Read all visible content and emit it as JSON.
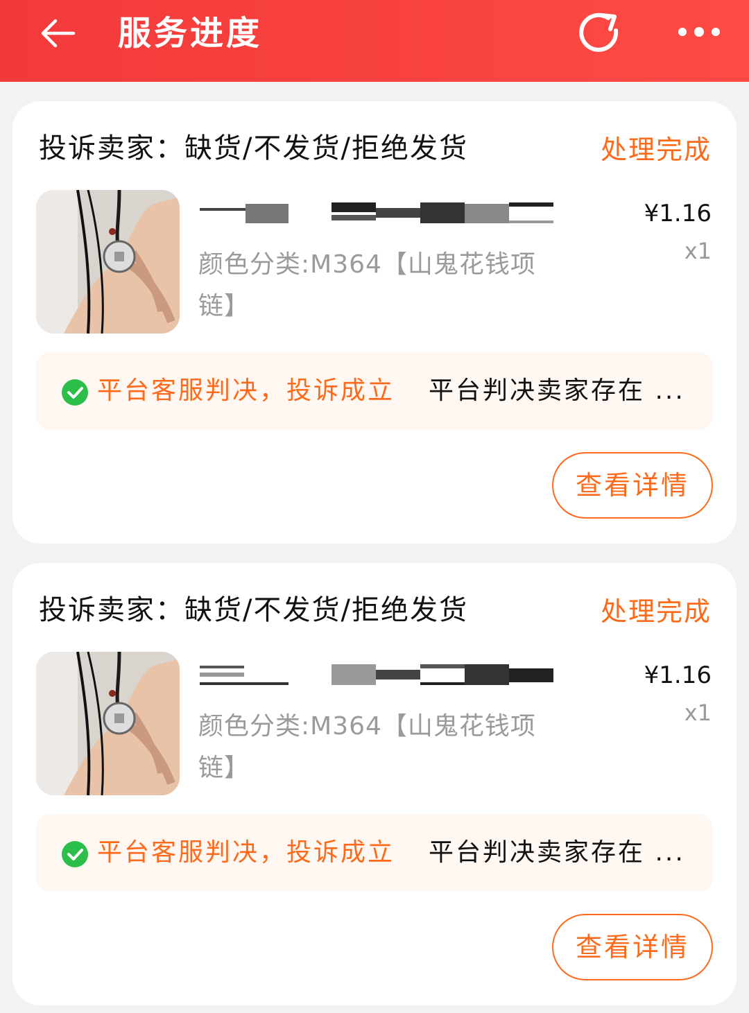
{
  "header": {
    "title": "服务进度",
    "bg_color": "#f23a3a"
  },
  "cards": [
    {
      "complaint": "投诉卖家：缺货/不发货/拒绝发货",
      "status": "处理完成",
      "variant": "颜色分类:M364【山鬼花钱项链】",
      "price": "¥1.16",
      "qty": "x1",
      "verdict_label": "平台客服判决，投诉成立",
      "verdict_text": "平台判决卖家存在 ...",
      "detail_button": "查看详情"
    },
    {
      "complaint": "投诉卖家：缺货/不发货/拒绝发货",
      "status": "处理完成",
      "variant": "颜色分类:M364【山鬼花钱项链】",
      "price": "¥1.16",
      "qty": "x1",
      "verdict_label": "平台客服判决，投诉成立",
      "verdict_text": "平台判决卖家存在 ...",
      "detail_button": "查看详情"
    }
  ],
  "colors": {
    "accent": "#ff6a1a",
    "success": "#2bbf4a"
  }
}
